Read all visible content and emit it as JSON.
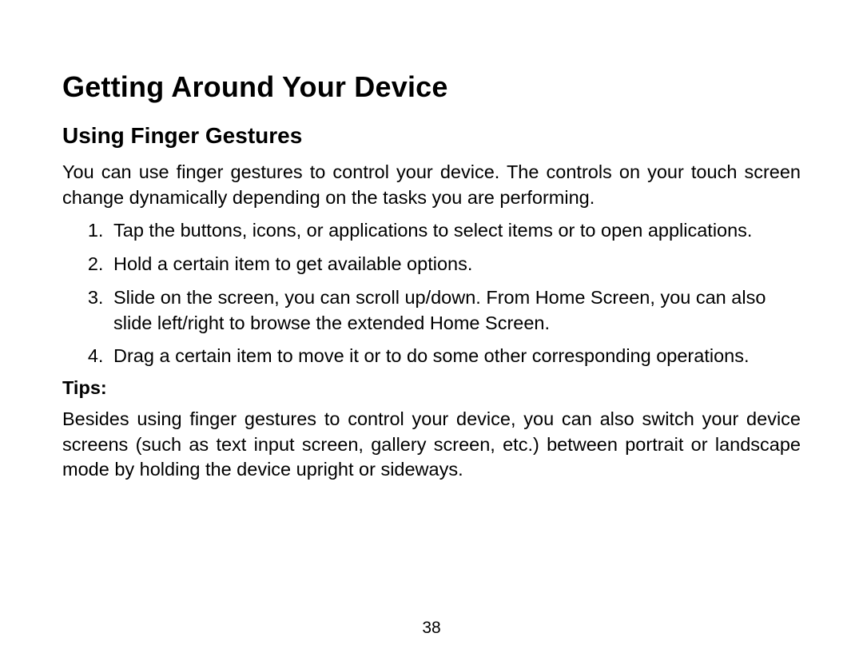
{
  "heading1": "Getting Around Your Device",
  "heading2": "Using Finger Gestures",
  "intro": "You can use finger gestures to control your device. The controls on your touch screen change dynamically depending on the tasks you are performing.",
  "steps": [
    "Tap the buttons, icons, or applications to select items or to open applications.",
    "Hold a certain item to get available options.",
    "Slide on the screen, you can scroll up/down. From Home Screen, you can also slide left/right to browse the extended Home Screen.",
    "Drag a certain item to move it or to do some other corresponding operations."
  ],
  "tips_label": "Tips:",
  "tips_body": "Besides using finger gestures to control your device, you can also switch your device screens (such as text input screen, gallery screen, etc.) between portrait or landscape mode by holding the device upright or sideways.",
  "page_number": "38"
}
